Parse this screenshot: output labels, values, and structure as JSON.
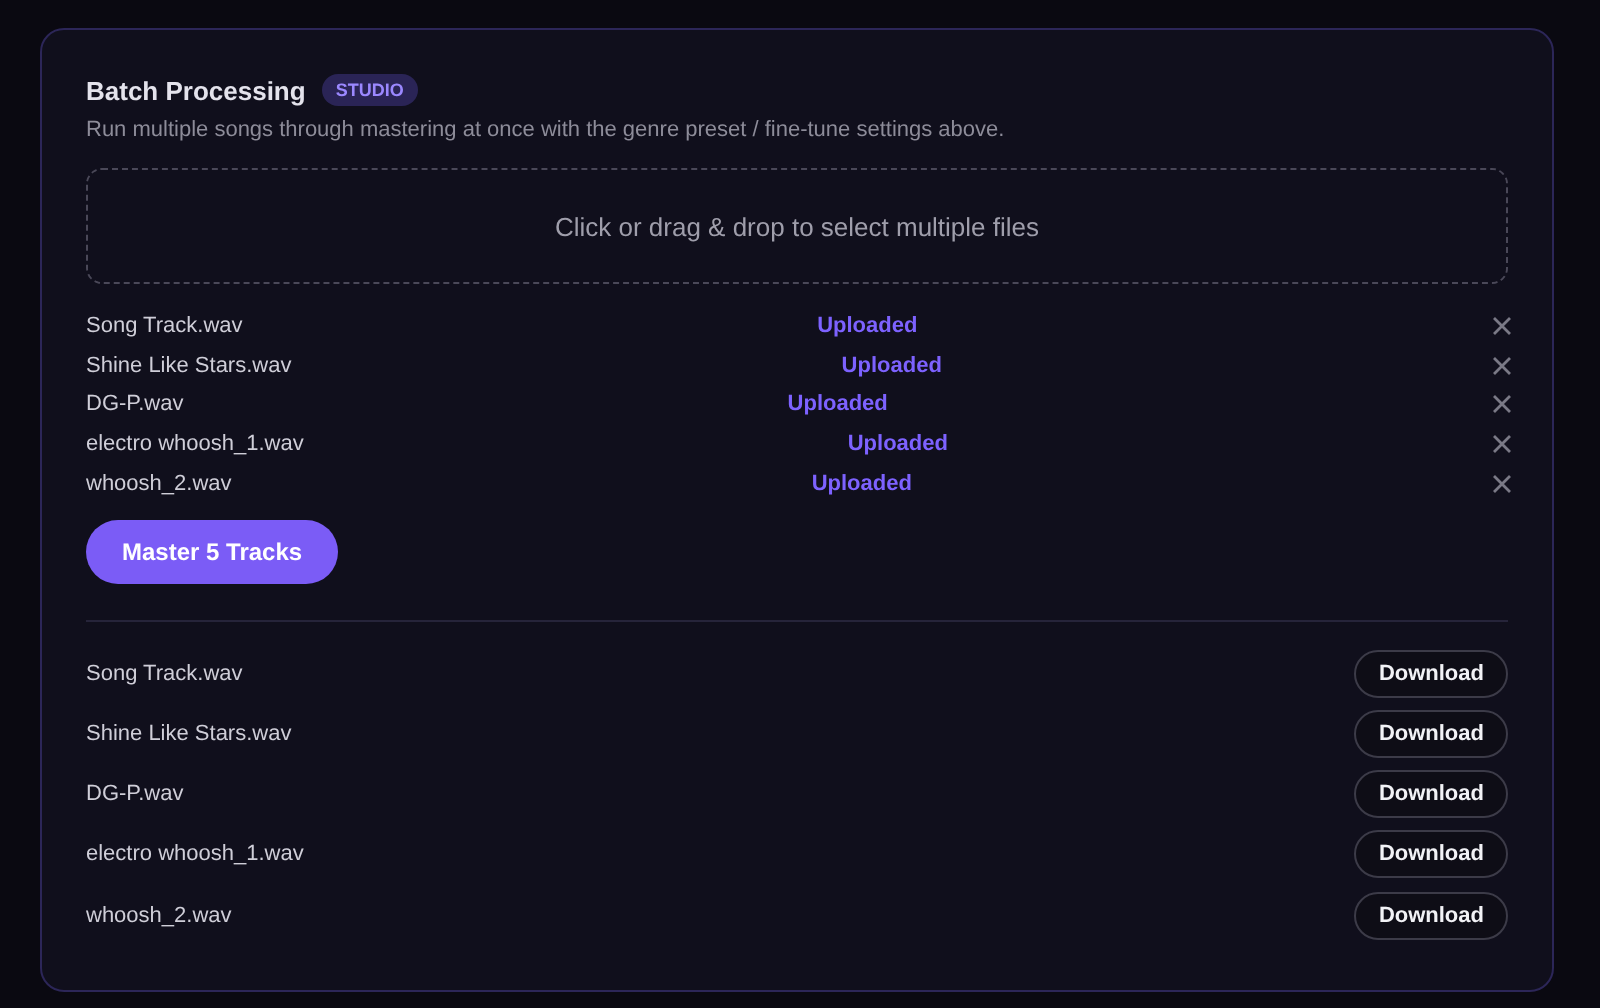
{
  "panel": {
    "title": "Batch Processing",
    "badge": "STUDIO",
    "description": "Run multiple songs through mastering at once with the genre preset / fine-tune settings above."
  },
  "dropzone": {
    "label": "Click or drag & drop to select multiple files"
  },
  "uploads": [
    {
      "name": "Song Track.wav",
      "status": "Uploaded"
    },
    {
      "name": "Shine Like Stars.wav",
      "status": "Uploaded"
    },
    {
      "name": "DG-P.wav",
      "status": "Uploaded"
    },
    {
      "name": "electro whoosh_1.wav",
      "status": "Uploaded"
    },
    {
      "name": "whoosh_2.wav",
      "status": "Uploaded"
    }
  ],
  "master_button": "Master 5 Tracks",
  "results": [
    {
      "name": "Song Track.wav",
      "action": "Download"
    },
    {
      "name": "Shine Like Stars.wav",
      "action": "Download"
    },
    {
      "name": "DG-P.wav",
      "action": "Download"
    },
    {
      "name": "electro whoosh_1.wav",
      "action": "Download"
    },
    {
      "name": "whoosh_2.wav",
      "action": "Download"
    }
  ]
}
